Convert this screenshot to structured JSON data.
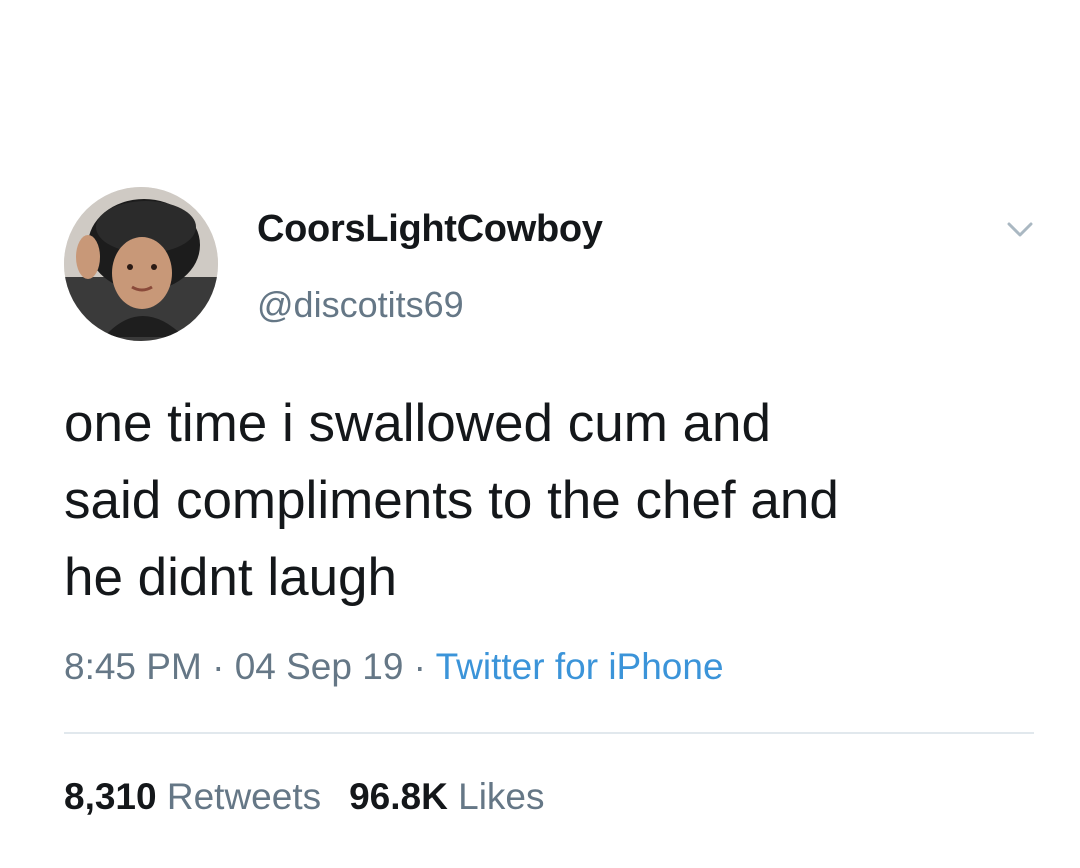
{
  "user": {
    "display_name": "CoorsLightCowboy",
    "handle": "@discotits69"
  },
  "tweet": {
    "text": "one time i swallowed cum and\nsaid compliments to the chef and\nhe didnt laugh",
    "time": "8:45 PM",
    "date": "04 Sep 19",
    "separator": " · ",
    "source": "Twitter for iPhone"
  },
  "stats": {
    "retweets_count": "8,310",
    "retweets_label": "Retweets",
    "likes_count": "96.8K",
    "likes_label": "Likes"
  },
  "colors": {
    "text": "#14171a",
    "secondary": "#657786",
    "link": "#3b94d9",
    "divider": "#e1e8ed"
  },
  "icons": {
    "menu": "chevron-down-icon"
  }
}
